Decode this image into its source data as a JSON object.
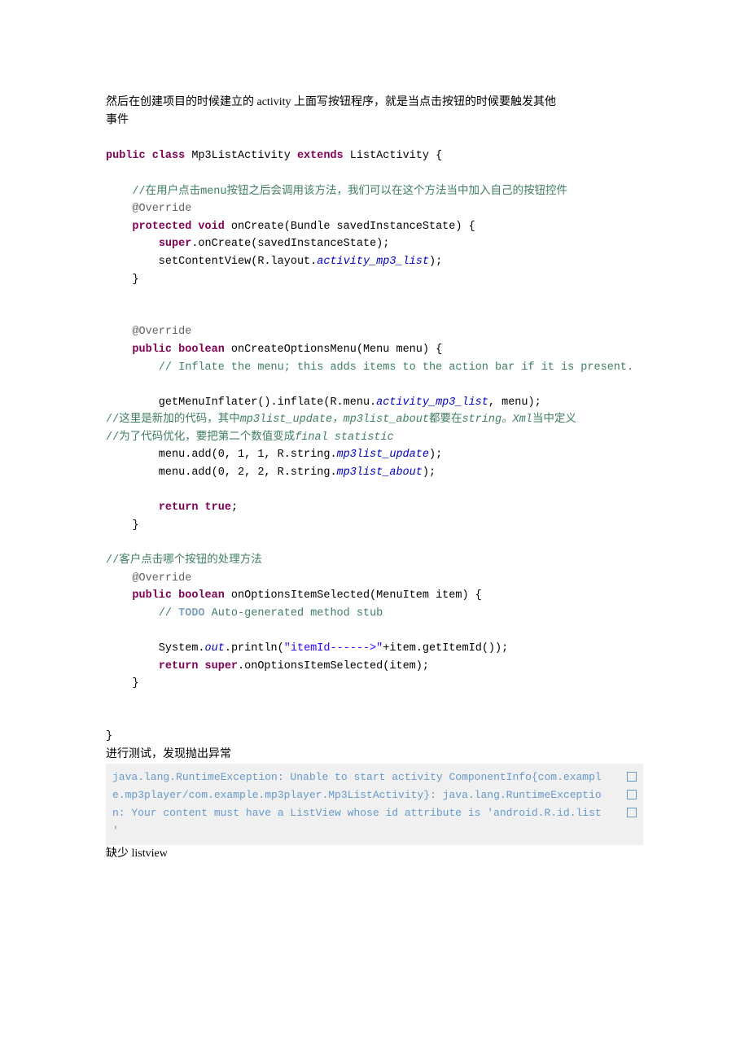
{
  "p1a": "然后在创建项目的时候建立的 activity 上面写按钮程序，就是当点击按钮的时候要触发其他",
  "p1b": "事件",
  "c1": "public class",
  "c2": " Mp3ListActivity ",
  "c3": "extends",
  "c4": " ListActivity {",
  "cm1": "//在用户点击menu按钮之后会调用该方法，我们可以在这个方法当中加入自己的按钮控件",
  "ann1": "@Override",
  "m1a": "protected void",
  "m1b": " onCreate(Bundle savedInstanceState) {",
  "m1c": "super",
  "m1d": ".onCreate(savedInstanceState);",
  "m1e": "        setContentView(R.layout.",
  "m1f": "activity_mp3_list",
  "m1g": ");",
  "ann2": "@Override",
  "m2a": "public boolean",
  "m2b": " onCreateOptionsMenu(Menu menu) {",
  "cm2": "// Inflate the menu; this adds items to the action bar if it is present.",
  "m2c": "        getMenuInflater().inflate(R.menu.",
  "m2d": "activity_mp3_list",
  "m2e": ", menu);",
  "cm3a": "//这里是新加的代码，其中",
  "cm3b": "mp3list_update，mp3list_about",
  "cm3c": "都要在",
  "cm3d": "string。Xml",
  "cm3e": "当中定义",
  "cm4a": "//为了代码优化，要把第二个数值变成",
  "cm4b": "final statistic",
  "m2f": "        menu.add(0, 1, 1, R.string.",
  "m2g": "mp3list_update",
  "m2h": ");",
  "m2i": "        menu.add(0, 2, 2, R.string.",
  "m2j": "mp3list_about",
  "m2k": ");",
  "m2l": "return true",
  "m2m": ";",
  "cm5": "//客户点击哪个按钮的处理方法",
  "ann3": "@Override",
  "m3a": "public boolean",
  "m3b": " onOptionsItemSelected(MenuItem item) {",
  "cm6a": "// ",
  "cm6b": "TODO",
  "cm6c": " Auto-generated method stub",
  "m3c": "        System.",
  "m3d": "out",
  "m3e": ".println(",
  "m3f": "\"itemId------>\"",
  "m3g": "+item.getItemId());",
  "m3h": "return super",
  "m3i": ".onOptionsItemSelected(item);",
  "p2": "进行测试，发现抛出异常",
  "e1": "java.lang.RuntimeException: Unable to start activity ComponentInfo{com.exampl",
  "e2": "e.mp3player/com.example.mp3player.Mp3ListActivity}: java.lang.RuntimeExceptio",
  "e3": "n: Your content must have a ListView whose id attribute is 'android.R.id.list",
  "e4": "'",
  "p3": "缺少 listview"
}
